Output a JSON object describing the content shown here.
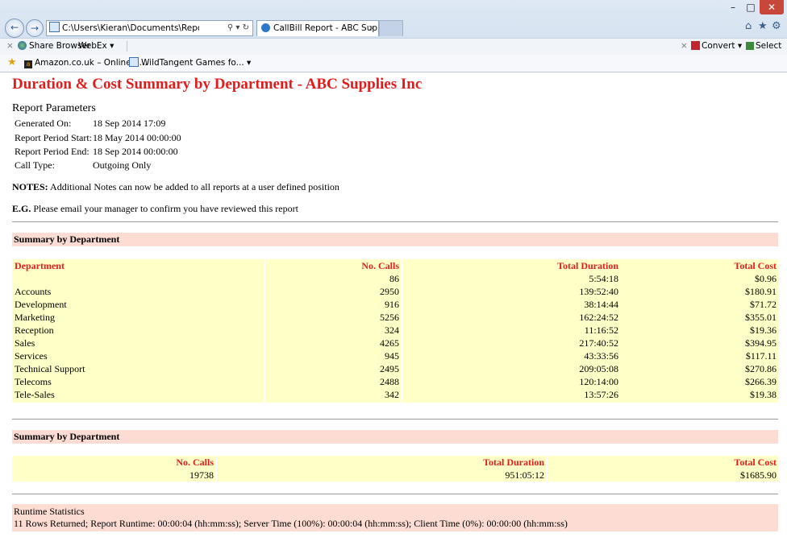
{
  "browser": {
    "window_buttons": {
      "minimize": "–",
      "maximize": "□",
      "close": "✕"
    },
    "address": "C:\\Users\\Kieran\\Documents\\Report with Notes.ht",
    "address_icons": "⚲ ▾ ↻",
    "tab_title": "CallBill Report - ABC Suppli...",
    "toolbar": {
      "share_browser": "Share Browser",
      "webex": "WebEx ▾",
      "convert": "Convert ▾",
      "select": "Select"
    },
    "favorites": [
      "Amazon.co.uk – Online S...",
      "WildTangent Games fo... ▾"
    ]
  },
  "report": {
    "title": "Duration & Cost Summary by Department - ABC Supplies Inc",
    "params_heading": "Report Parameters",
    "params": [
      {
        "label": "Generated On:",
        "value": "18 Sep 2014 17:09"
      },
      {
        "label": "Report Period Start:",
        "value": "18 May 2014 00:00:00"
      },
      {
        "label": "Report Period End:",
        "value": "18 Sep 2014 00:00:00"
      },
      {
        "label": "Call Type:",
        "value": "Outgoing Only"
      }
    ],
    "notes_label": "NOTES:",
    "notes_text": " Additional Notes can now be added to all reports at a user defined position",
    "eg_label": "E.G.",
    "eg_text": " Please email your manager to confirm you have reviewed this report",
    "section1_title": "Summary by Department",
    "dept_table": {
      "headers": [
        "Department",
        "No. Calls",
        "Total Duration",
        "Total Cost"
      ],
      "rows": [
        [
          "",
          "86",
          "5:54:18",
          "$0.96"
        ],
        [
          "Accounts",
          "2950",
          "139:52:40",
          "$180.91"
        ],
        [
          "Development",
          "916",
          "38:14:44",
          "$71.72"
        ],
        [
          "Marketing",
          "5256",
          "162:24:52",
          "$355.01"
        ],
        [
          "Reception",
          "324",
          "11:16:52",
          "$19.36"
        ],
        [
          "Sales",
          "4265",
          "217:40:52",
          "$394.95"
        ],
        [
          "Services",
          "945",
          "43:33:56",
          "$117.11"
        ],
        [
          "Technical Support",
          "2495",
          "209:05:08",
          "$270.86"
        ],
        [
          "Telecoms",
          "2488",
          "120:14:00",
          "$266.39"
        ],
        [
          "Tele-Sales",
          "342",
          "13:57:26",
          "$19.38"
        ]
      ]
    },
    "section2_title": "Summary by Department",
    "totals_table": {
      "headers": [
        "No. Calls",
        "Total Duration",
        "Total Cost"
      ],
      "row": [
        "19738",
        "951:05:12",
        "$1685.90"
      ]
    },
    "runtime_title": "Runtime Statistics",
    "runtime_text": "11 Rows Returned; Report Runtime: 00:00:04 (hh:mm:ss); Server Time (100%): 00:00:04 (hh:mm:ss); Client Time (0%): 00:00:00 (hh:mm:ss)"
  }
}
